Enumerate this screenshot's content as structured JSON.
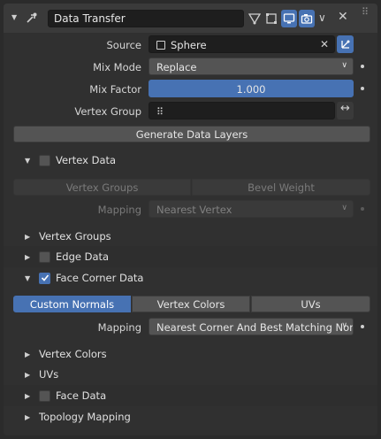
{
  "modifier": {
    "name": "Data Transfer"
  },
  "fields": {
    "source_label": "Source",
    "source_value": "Sphere",
    "mix_mode_label": "Mix Mode",
    "mix_mode_value": "Replace",
    "mix_factor_label": "Mix Factor",
    "mix_factor_value": "1.000",
    "vertex_group_label": "Vertex Group",
    "generate_button": "Generate Data Layers"
  },
  "vertex_data": {
    "label": "Vertex Data",
    "checked": false,
    "tab_vertex_groups": "Vertex Groups",
    "tab_bevel_weight": "Bevel Weight",
    "mapping_label": "Mapping",
    "mapping_value": "Nearest Vertex",
    "sub_vertex_groups": "Vertex Groups"
  },
  "edge_data": {
    "label": "Edge Data",
    "checked": false
  },
  "face_corner_data": {
    "label": "Face Corner Data",
    "checked": true,
    "tab_custom_normals": "Custom Normals",
    "tab_vertex_colors": "Vertex Colors",
    "tab_uvs": "UVs",
    "mapping_label": "Mapping",
    "mapping_value": "Nearest Corner And Best Matching Normal",
    "sub_vertex_colors": "Vertex Colors",
    "sub_uvs": "UVs"
  },
  "face_data": {
    "label": "Face Data",
    "checked": false
  },
  "topology": {
    "label": "Topology Mapping"
  },
  "colors": {
    "accent": "#4772b3",
    "panel": "#303030",
    "field": "#545454"
  }
}
